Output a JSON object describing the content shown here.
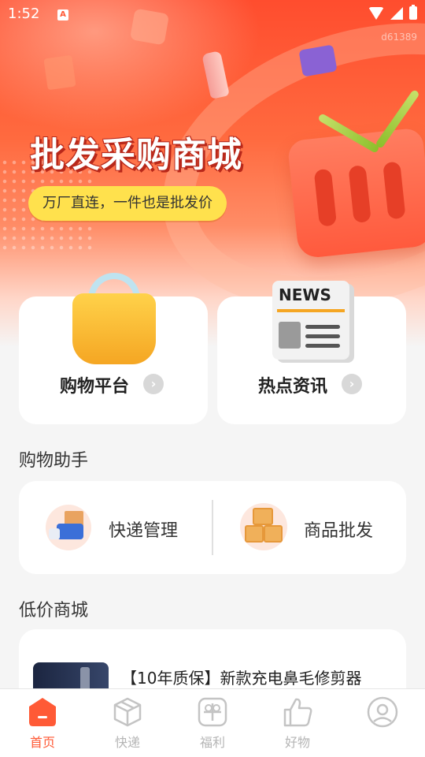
{
  "status_bar": {
    "time": "1:52",
    "notification_letter": "A"
  },
  "watermark": "d61389",
  "hero": {
    "title": "批发采购商城",
    "subtitle": "万厂直连，一件也是批发价"
  },
  "nav_cards": [
    {
      "label": "购物平台",
      "icon": "shopping-bag-icon"
    },
    {
      "label": "热点资讯",
      "icon": "newspaper-icon",
      "icon_text": "NEWS"
    }
  ],
  "shopping_helper": {
    "title": "购物助手",
    "items": [
      {
        "label": "快递管理",
        "icon": "delivery-truck-icon"
      },
      {
        "label": "商品批发",
        "icon": "boxes-icon"
      }
    ]
  },
  "low_price_mall": {
    "title": "低价商城",
    "products": [
      {
        "title": "【10年质保】新款充电鼻毛修剪器"
      }
    ]
  },
  "tab_bar": {
    "tabs": [
      {
        "label": "首页",
        "icon": "home-icon",
        "active": true
      },
      {
        "label": "快递",
        "icon": "package-icon",
        "active": false
      },
      {
        "label": "福利",
        "icon": "gift-icon",
        "active": false
      },
      {
        "label": "好物",
        "icon": "thumbs-up-icon",
        "active": false
      },
      {
        "label": "",
        "icon": "profile-icon",
        "active": false
      }
    ]
  },
  "colors": {
    "accent": "#ff5a36",
    "pill": "#ffe14d",
    "inactive_tab": "#b5b5b5"
  }
}
